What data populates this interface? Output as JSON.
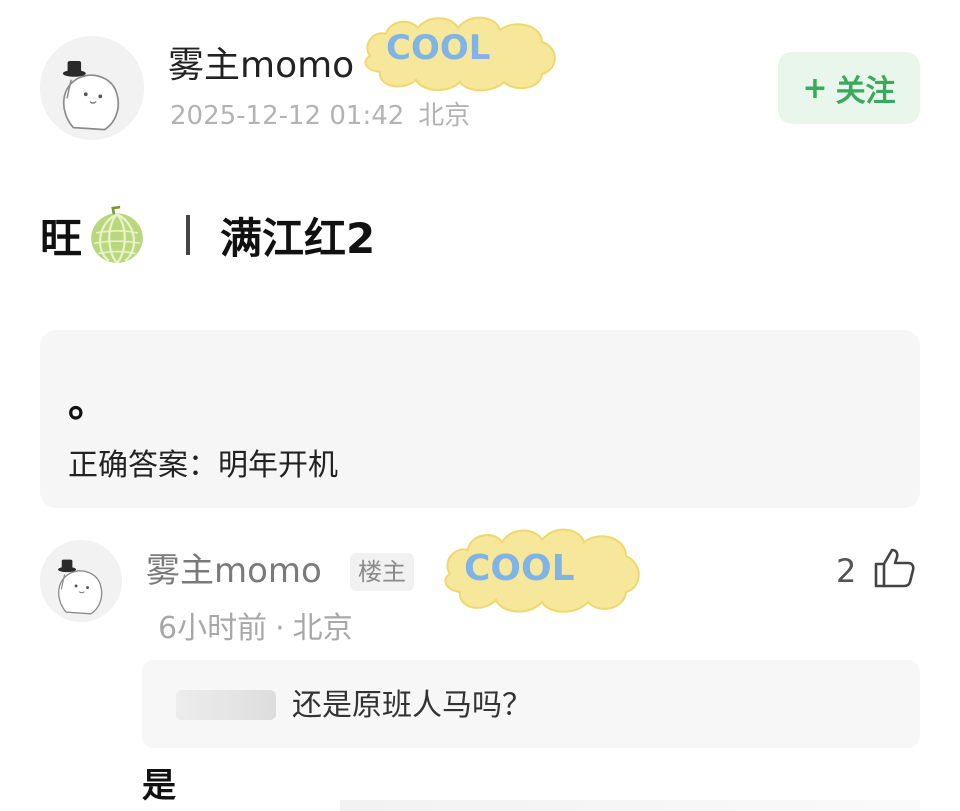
{
  "post": {
    "author": "雾主momo",
    "date": "2025-12-12 01:42",
    "location": "北京",
    "follow_plus": "+",
    "follow_label": "关注",
    "title_prefix": "旺",
    "title_divider": "|",
    "title_main": "满江红2"
  },
  "quote_card": {
    "dot": "。",
    "answer": "正确答案：明年开机"
  },
  "comment": {
    "author": "雾主momo",
    "op_badge": "楼主",
    "time": "6小时前",
    "separator": "·",
    "location": "北京",
    "like_count": "2",
    "reply_quote_text": "还是原班人马吗？",
    "body": "是"
  },
  "badges": {
    "cool_text": "COOL"
  },
  "colors": {
    "follow_bg": "#e9f6ec",
    "follow_text": "#3aa95c",
    "card_bg": "#f6f6f6",
    "meta_text": "#b3b3b3"
  },
  "icons": [
    "avatar-cat-icon",
    "cool-badge-icon",
    "melon-icon",
    "thumbs-up-icon"
  ]
}
